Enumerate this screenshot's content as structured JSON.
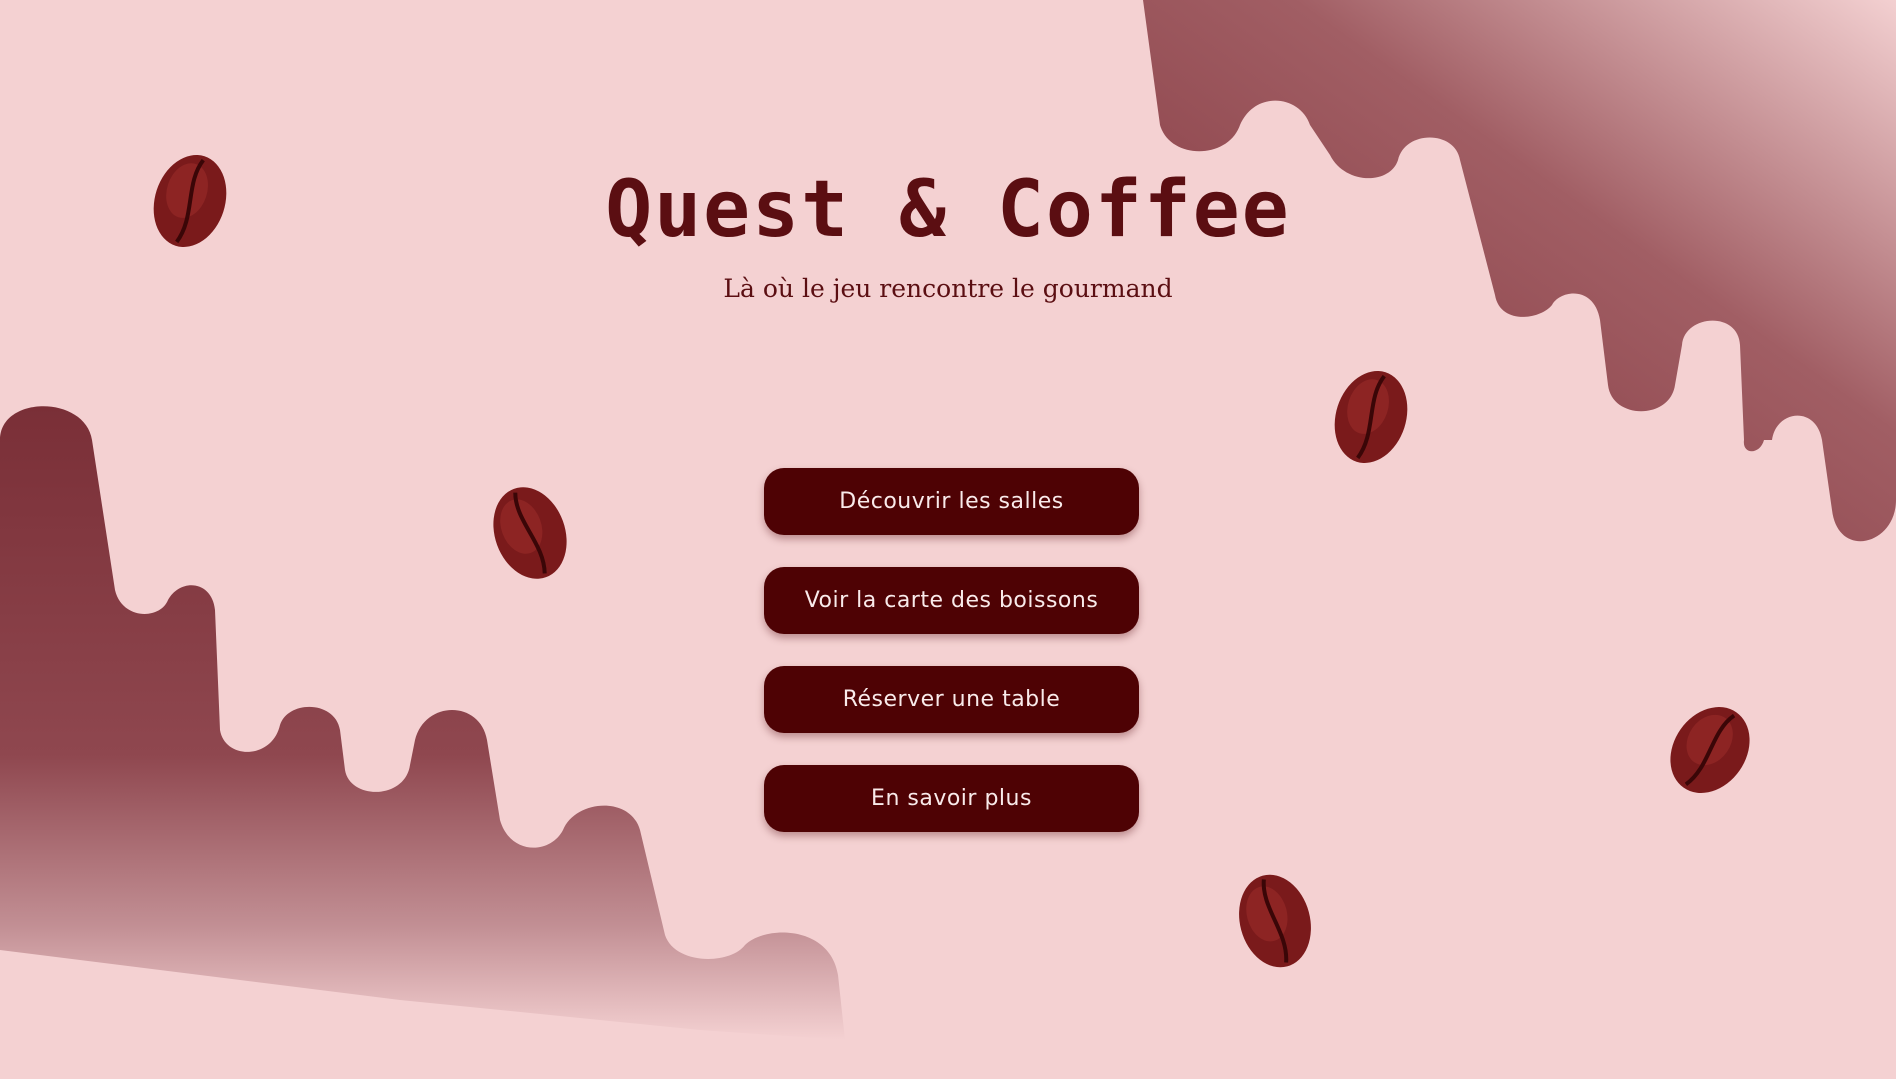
{
  "brand": {
    "title": "Quest & Coffee",
    "subtitle": "Là où le jeu rencontre le gourmand"
  },
  "menu": {
    "items": [
      {
        "label": "Découvrir les salles"
      },
      {
        "label": "Voir la carte des boissons"
      },
      {
        "label": "Réserver une table"
      },
      {
        "label": "En savoir plus"
      }
    ]
  },
  "colors": {
    "background": "#f4d1d2",
    "accent": "#5b0e12",
    "button_bg": "#4e0204",
    "button_text": "#f9eaea",
    "drip": "#8a4148"
  },
  "decorations": {
    "icons": [
      "coffee-bean-icon",
      "chocolate-drip-shape"
    ]
  }
}
